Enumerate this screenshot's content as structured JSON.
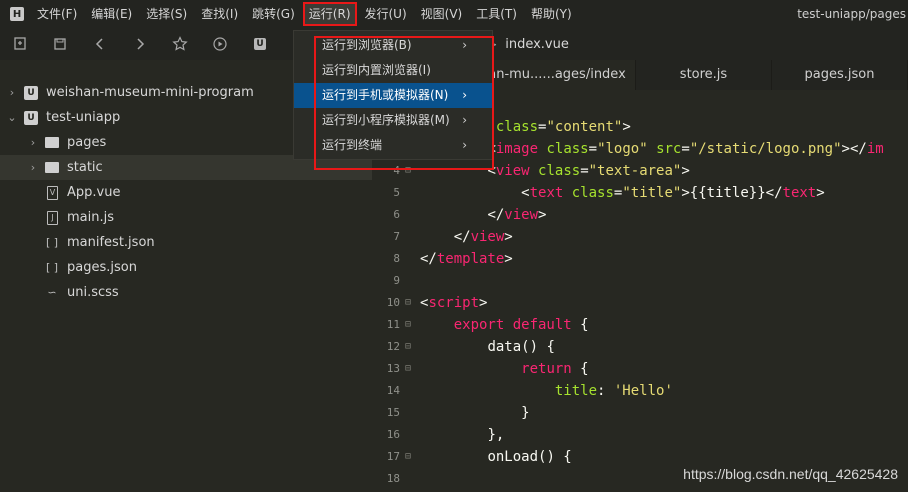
{
  "menubar": {
    "logo": "H",
    "items": [
      "文件(F)",
      "编辑(E)",
      "选择(S)",
      "查找(I)",
      "跳转(G)",
      "运行(R)",
      "发行(U)",
      "视图(V)",
      "工具(T)",
      "帮助(Y)"
    ],
    "window_title": "test-uniapp/pages"
  },
  "toolbar": {
    "u_badge": "U",
    "icons": [
      "new-file-icon",
      "save-icon",
      "back-icon",
      "forward-icon",
      "star-icon",
      "run-icon"
    ]
  },
  "run_menu": {
    "items": [
      {
        "label": "运行到浏览器(B)",
        "has_submenu": true
      },
      {
        "label": "运行到内置浏览器(I)",
        "has_submenu": false
      },
      {
        "label": "运行到手机或模拟器(N)",
        "has_submenu": true
      },
      {
        "label": "运行到小程序模拟器(M)",
        "has_submenu": true
      },
      {
        "label": "运行到终端",
        "has_submenu": true
      }
    ],
    "highlight_index": 2
  },
  "sidebar": {
    "projects": [
      {
        "name": "weishan-museum-mini-program",
        "expanded": false
      },
      {
        "name": "test-uniapp",
        "expanded": true
      }
    ],
    "children": [
      {
        "name": "pages",
        "type": "folder"
      },
      {
        "name": "static",
        "type": "folder"
      },
      {
        "name": "App.vue",
        "type": "file",
        "icon": "V"
      },
      {
        "name": "main.js",
        "type": "file",
        "icon": "J"
      },
      {
        "name": "manifest.json",
        "type": "json",
        "icon": "[ ]"
      },
      {
        "name": "pages.json",
        "type": "json",
        "icon": "[ ]"
      },
      {
        "name": "uni.scss",
        "type": "scss",
        "icon": "∽"
      }
    ]
  },
  "breadcrumb": {
    "separator": ">",
    "current": "index.vue"
  },
  "editor_tabs": [
    "han-mu......ages/index",
    "store.js",
    "pages.json"
  ],
  "code": {
    "line_numbers": [
      "",
      "",
      "",
      "4",
      "5",
      "6",
      "7",
      "8",
      "9",
      "10",
      "11",
      "12",
      "13",
      "14",
      "15",
      "16",
      "17",
      "18"
    ],
    "fold_markers": [
      "",
      "",
      "",
      "⊟",
      "",
      "",
      "",
      "",
      "",
      "⊟",
      "⊟",
      "⊟",
      "⊟",
      "",
      "",
      "",
      "⊟",
      ""
    ],
    "lines": [
      [
        {
          "t": "    ",
          "c": "txt"
        },
        {
          "t": "ate",
          "c": "tag"
        },
        {
          "t": ">",
          "c": "txt"
        }
      ],
      [
        {
          "t": "      ",
          "c": "txt"
        },
        {
          "t": "ew",
          "c": "tag"
        },
        {
          "t": " ",
          "c": "txt"
        },
        {
          "t": "class",
          "c": "attr"
        },
        {
          "t": "=",
          "c": "txt"
        },
        {
          "t": "\"content\"",
          "c": "str"
        },
        {
          "t": ">",
          "c": "txt"
        }
      ],
      [
        {
          "t": "        ",
          "c": "txt"
        },
        {
          "t": "<",
          "c": "txt"
        },
        {
          "t": "image",
          "c": "tag"
        },
        {
          "t": " ",
          "c": "txt"
        },
        {
          "t": "class",
          "c": "attr"
        },
        {
          "t": "=",
          "c": "txt"
        },
        {
          "t": "\"logo\"",
          "c": "str"
        },
        {
          "t": " ",
          "c": "txt"
        },
        {
          "t": "src",
          "c": "attr"
        },
        {
          "t": "=",
          "c": "txt"
        },
        {
          "t": "\"/static/logo.png\"",
          "c": "str"
        },
        {
          "t": "></",
          "c": "txt"
        },
        {
          "t": "im",
          "c": "tag"
        }
      ],
      [
        {
          "t": "        ",
          "c": "txt"
        },
        {
          "t": "<",
          "c": "txt"
        },
        {
          "t": "view",
          "c": "tag"
        },
        {
          "t": " ",
          "c": "txt"
        },
        {
          "t": "class",
          "c": "attr"
        },
        {
          "t": "=",
          "c": "txt"
        },
        {
          "t": "\"text-area\"",
          "c": "str"
        },
        {
          "t": ">",
          "c": "txt"
        }
      ],
      [
        {
          "t": "            ",
          "c": "txt"
        },
        {
          "t": "<",
          "c": "txt"
        },
        {
          "t": "text",
          "c": "tag"
        },
        {
          "t": " ",
          "c": "txt"
        },
        {
          "t": "class",
          "c": "attr"
        },
        {
          "t": "=",
          "c": "txt"
        },
        {
          "t": "\"title\"",
          "c": "str"
        },
        {
          "t": ">{{title}}</",
          "c": "txt"
        },
        {
          "t": "text",
          "c": "tag"
        },
        {
          "t": ">",
          "c": "txt"
        }
      ],
      [
        {
          "t": "        ",
          "c": "txt"
        },
        {
          "t": "</",
          "c": "txt"
        },
        {
          "t": "view",
          "c": "tag"
        },
        {
          "t": ">",
          "c": "txt"
        }
      ],
      [
        {
          "t": "    ",
          "c": "txt"
        },
        {
          "t": "</",
          "c": "txt"
        },
        {
          "t": "view",
          "c": "tag"
        },
        {
          "t": ">",
          "c": "txt"
        }
      ],
      [
        {
          "t": "</",
          "c": "txt"
        },
        {
          "t": "template",
          "c": "tag"
        },
        {
          "t": ">",
          "c": "txt"
        }
      ],
      [
        {
          "t": "",
          "c": "txt"
        }
      ],
      [
        {
          "t": "<",
          "c": "txt"
        },
        {
          "t": "script",
          "c": "tag"
        },
        {
          "t": ">",
          "c": "txt"
        }
      ],
      [
        {
          "t": "    ",
          "c": "txt"
        },
        {
          "t": "export default",
          "c": "kw"
        },
        {
          "t": " {",
          "c": "txt"
        }
      ],
      [
        {
          "t": "        ",
          "c": "txt"
        },
        {
          "t": "data() {",
          "c": "txt"
        }
      ],
      [
        {
          "t": "            ",
          "c": "txt"
        },
        {
          "t": "return",
          "c": "kw"
        },
        {
          "t": " {",
          "c": "txt"
        }
      ],
      [
        {
          "t": "                ",
          "c": "txt"
        },
        {
          "t": "title",
          "c": "prop"
        },
        {
          "t": ": ",
          "c": "txt"
        },
        {
          "t": "'Hello'",
          "c": "str"
        }
      ],
      [
        {
          "t": "            ",
          "c": "txt"
        },
        {
          "t": "}",
          "c": "txt"
        }
      ],
      [
        {
          "t": "        ",
          "c": "txt"
        },
        {
          "t": "},",
          "c": "txt"
        }
      ],
      [
        {
          "t": "        ",
          "c": "txt"
        },
        {
          "t": "onLoad() {",
          "c": "txt"
        }
      ],
      [
        {
          "t": "",
          "c": "txt"
        }
      ]
    ]
  },
  "watermark": "https://blog.csdn.net/qq_42625428",
  "colors": {
    "highlight": "#09528e",
    "annotation_red": "#e81818",
    "background": "#272822"
  }
}
